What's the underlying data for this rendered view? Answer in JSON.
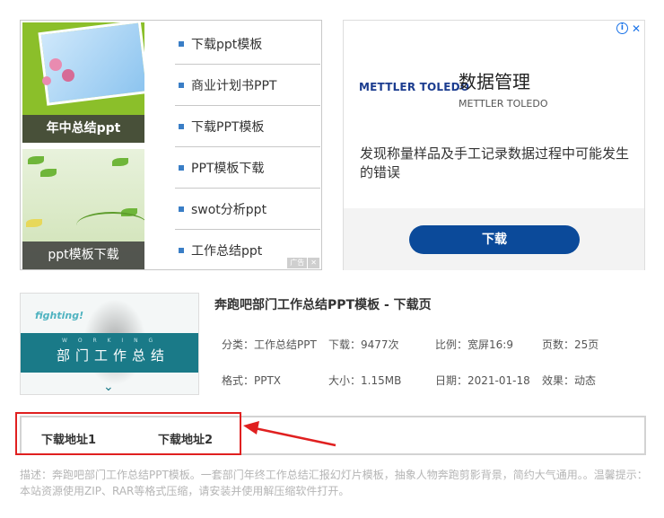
{
  "left_ad": {
    "thumbnails": [
      {
        "caption": "年中总结ppt"
      },
      {
        "caption": "ppt模板下载"
      }
    ],
    "links": [
      "下载ppt模板",
      "商业计划书PPT",
      "下载PPT模板",
      "PPT模板下载",
      "swot分析ppt",
      "工作总结ppt"
    ],
    "ad_tag": "广告"
  },
  "right_ad": {
    "brand_logo": "METTLER TOLEDO",
    "title": "数据管理",
    "subtitle": "METTLER TOLEDO",
    "description": "发现称量样品及手工记录数据过程中可能发生的错误",
    "button_label": "下载",
    "info_icon": "i",
    "close_icon": "✕"
  },
  "product": {
    "title": "奔跑吧部门工作总结PPT模板 - 下载页",
    "image_text": {
      "fighting": "fighting!",
      "working": "W O R K I N G",
      "cn": "部门工作总结"
    },
    "meta": {
      "category": "分类：工作总结PPT",
      "downloads": "下载：9477次",
      "ratio": "比例：宽屏16:9",
      "pages": "页数：25页",
      "format": "格式：PPTX",
      "size": "大小：1.15MB",
      "date": "日期：2021-01-18",
      "effect": "效果：动态"
    }
  },
  "downloads": {
    "link1": "下载地址1",
    "link2": "下载地址2"
  },
  "description": "描述：奔跑吧部门工作总结PPT模板。一套部门年终工作总结汇报幻灯片模板，抽象人物奔跑剪影背景，简约大气通用。。温馨提示：本站资源使用ZIP、RAR等格式压缩，请安装并使用解压缩软件打开。",
  "colors": {
    "accent_blue": "#0b4a9a",
    "highlight_red": "#e02020",
    "bullet_blue": "#3a7ec6"
  }
}
